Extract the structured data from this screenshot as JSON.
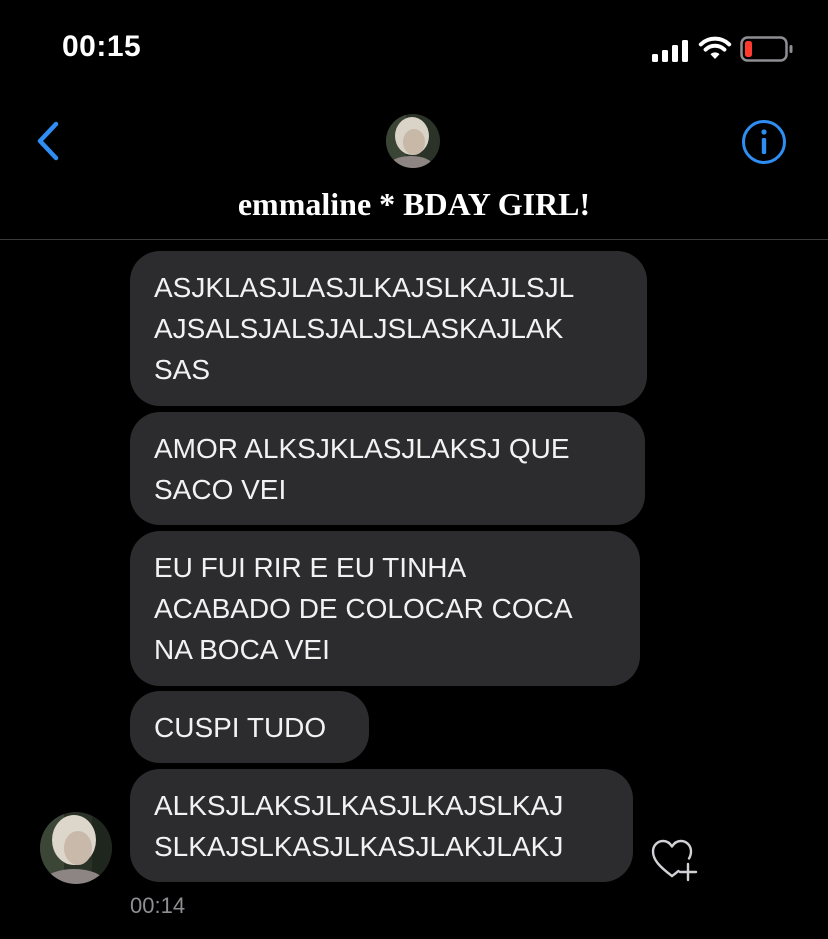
{
  "status_bar": {
    "time": "00:15",
    "icons": [
      "signal-icon",
      "wifi-icon",
      "battery-icon"
    ],
    "battery_color": "#ff3b30"
  },
  "header": {
    "title": "emmaline * BDAY GIRL!",
    "back_icon": "chevron-left-icon",
    "info_icon": "info-icon",
    "accent_color": "#2f8ef4"
  },
  "messages": [
    {
      "text": "ASJKLASJLASJLKAJSLKAJLSJL\nAJSALSJALSJALJSLASKAJLAK\nSAS"
    },
    {
      "text": "AMOR ALKSJKLASJLAKSJ QUE\nSACO VEI"
    },
    {
      "text": "EU FUI RIR E EU TINHA\nACABADO DE COLOCAR COCA\nNA BOCA VEI"
    },
    {
      "text": "CUSPI TUDO"
    },
    {
      "text": "ALKSJLAKSJLKASJLKAJSLKAJ\nSLKAJSLKASJLKASJLAKJLAKJ"
    }
  ],
  "last_message_time": "00:14",
  "like_icon": "heart-plus-icon",
  "bubble_color": "#2c2c2e"
}
